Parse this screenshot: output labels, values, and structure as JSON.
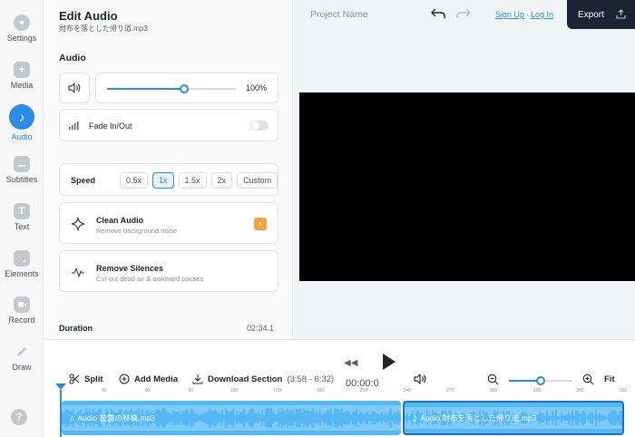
{
  "sidebar": {
    "items": [
      {
        "label": "Settings",
        "icon": "gear-icon"
      },
      {
        "label": "Media",
        "icon": "plus-icon"
      },
      {
        "label": "Audio",
        "icon": "music-note-icon",
        "active": true
      },
      {
        "label": "Subtitles",
        "icon": "subtitles-icon"
      },
      {
        "label": "Text",
        "icon": "text-icon"
      },
      {
        "label": "Elements",
        "icon": "elements-icon"
      },
      {
        "label": "Record",
        "icon": "record-icon"
      },
      {
        "label": "Draw",
        "icon": "pen-icon"
      }
    ],
    "help_label": "?"
  },
  "panel": {
    "title": "Edit Audio",
    "file_name": "財布を落とした帰り道.mp3",
    "section_audio": "Audio",
    "volume": {
      "value_label": "100%",
      "level": 0.6
    },
    "fade": {
      "label": "Fade In/Out",
      "enabled": false
    },
    "speed": {
      "label": "Speed",
      "options": [
        "0.5x",
        "1x",
        "1.5x",
        "2x",
        "Custom"
      ],
      "selected": "1x"
    },
    "clean_audio": {
      "title": "Clean Audio",
      "subtitle": "Remove background noise"
    },
    "remove_silences": {
      "title": "Remove Silences",
      "subtitle": "Cut out dead air & awkward pauses"
    },
    "duration": {
      "label": "Duration",
      "value": "02:34.1"
    }
  },
  "header": {
    "project_name": "Project Name",
    "sign_up": "Sign Up",
    "separator": "·",
    "log_in": "Log In",
    "export_label": "Export"
  },
  "timeline": {
    "split_label": "Split",
    "add_media_label": "Add Media",
    "download_label": "Download Section",
    "download_range": "(3:58 - 6:32)",
    "timecode": "00:00:0",
    "fit_label": "Fit",
    "zoom_level": 0.5,
    "ruler_ticks": [
      "30",
      "60",
      "90",
      "120",
      "150",
      "180",
      "210",
      "240",
      "270",
      "300",
      "330",
      "360",
      "390"
    ],
    "clips": [
      {
        "label": "Audio 披露の林檎.mp3",
        "selected": false
      },
      {
        "label": "Audio 財布を落とした帰り道.mp3",
        "selected": true
      }
    ]
  },
  "colors": {
    "accent": "#2b8be6",
    "clip": "#55b8f4",
    "export_bg": "#1c2433",
    "bolt": "#f5a33a"
  }
}
